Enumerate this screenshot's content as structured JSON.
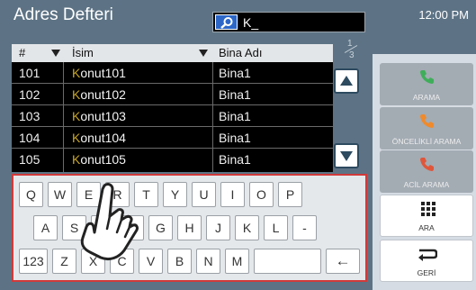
{
  "title": "Adres Defteri",
  "search": {
    "value": "K_"
  },
  "clock": "12:00 PM",
  "table": {
    "headers": {
      "num": "#",
      "name": "İsim",
      "building": "Bina Adı"
    },
    "rows": [
      {
        "num": "101",
        "name_hl": "K",
        "name_rest": "onut101",
        "building": "Bina1"
      },
      {
        "num": "102",
        "name_hl": "K",
        "name_rest": "onut102",
        "building": "Bina1"
      },
      {
        "num": "103",
        "name_hl": "K",
        "name_rest": "onut103",
        "building": "Bina1"
      },
      {
        "num": "104",
        "name_hl": "K",
        "name_rest": "onut104",
        "building": "Bina1"
      },
      {
        "num": "105",
        "name_hl": "K",
        "name_rest": "onut105",
        "building": "Bina1"
      }
    ],
    "page": {
      "current": "1",
      "total": "3"
    }
  },
  "keyboard": {
    "row1": [
      "Q",
      "W",
      "E",
      "R",
      "T",
      "Y",
      "U",
      "I",
      "O",
      "P"
    ],
    "row2": [
      "A",
      "S",
      "D",
      "F",
      "G",
      "H",
      "J",
      "K",
      "L",
      "-"
    ],
    "row3": [
      "123",
      "Z",
      "X",
      "C",
      "V",
      "B",
      "N",
      "M",
      " ",
      "←"
    ]
  },
  "buttons": {
    "call": "ARAMA",
    "priority_call": "ÖNCELİKLİ ARAMA",
    "emergency_call": "ACİL ARAMA",
    "dial": "ARA",
    "back": "GERİ"
  },
  "colors": {
    "panel": "#5d7385",
    "highlight": "#c9a628",
    "keyboard_border": "#d03a3a",
    "call_green": "#3fae5a",
    "call_orange": "#f08a2a",
    "call_red": "#e0563a"
  },
  "icons": {
    "search": "magnifier-icon",
    "scroll_up": "up-arrow-icon",
    "scroll_down": "down-arrow-icon",
    "phone": "phone-icon",
    "keypad": "keypad-icon",
    "back": "return-arrow-icon",
    "hand": "touch-hand-icon"
  }
}
